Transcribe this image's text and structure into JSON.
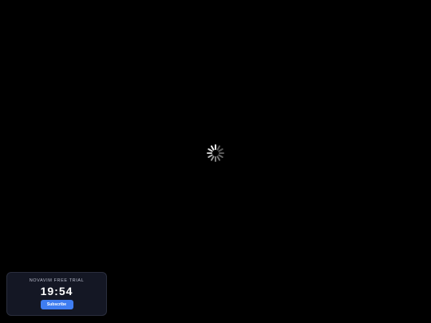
{
  "loading": {
    "icon": "spinner-icon",
    "color": "#ffffff"
  },
  "trial": {
    "label": "NOVAVIM FREE TRIAL",
    "timer": "19:54",
    "subscribe_label": "Subscribe",
    "accent": "#3f7df1"
  }
}
